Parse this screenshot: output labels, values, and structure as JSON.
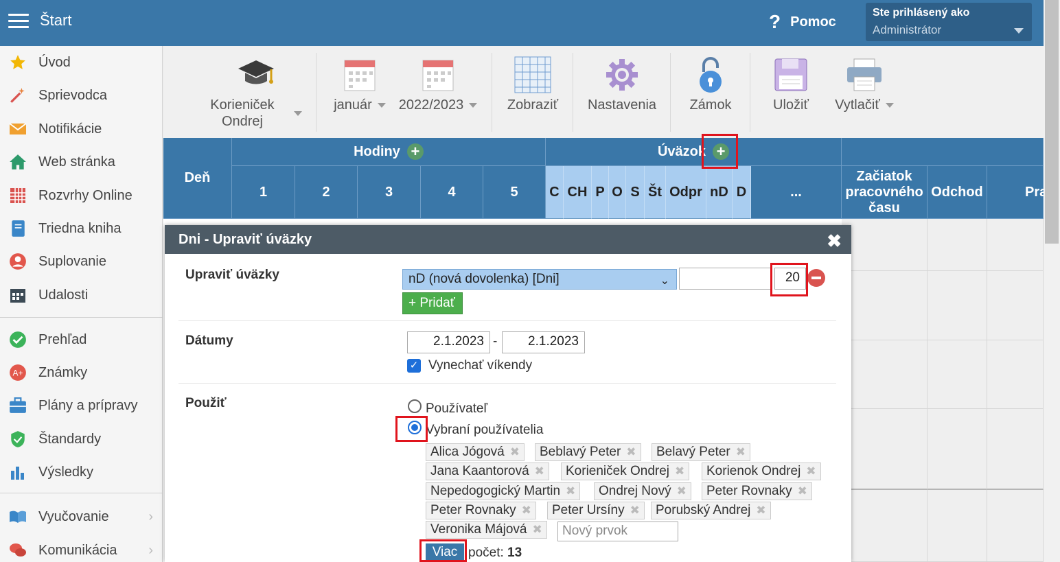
{
  "topbar": {
    "title": "Štart",
    "help_label": "Pomoc",
    "user_line1": "Ste prihlásený ako",
    "user_line2": "Administrátor"
  },
  "sidebar": {
    "items": [
      {
        "label": "Úvod",
        "icon": "star-icon"
      },
      {
        "label": "Sprievodca",
        "icon": "magic-wand-icon"
      },
      {
        "label": "Notifikácie",
        "icon": "envelope-icon"
      },
      {
        "label": "Web stránka",
        "icon": "house-icon"
      },
      {
        "label": "Rozvrhy Online",
        "icon": "timetable-grid-icon"
      },
      {
        "label": "Triedna kniha",
        "icon": "notebook-icon"
      },
      {
        "label": "Suplovanie",
        "icon": "user-icon"
      },
      {
        "label": "Udalosti",
        "icon": "calendar-icon"
      },
      {
        "label": "Prehľad",
        "icon": "check-circle-icon"
      },
      {
        "label": "Známky",
        "icon": "grade-circle-icon"
      },
      {
        "label": "Plány a prípravy",
        "icon": "briefcase-icon"
      },
      {
        "label": "Štandardy",
        "icon": "shield-check-icon"
      },
      {
        "label": "Výsledky",
        "icon": "bar-chart-icon"
      },
      {
        "label": "Vyučovanie",
        "icon": "open-book-icon"
      },
      {
        "label": "Komunikácia",
        "icon": "chat-bubbles-icon"
      }
    ]
  },
  "toolbar": {
    "teacher_line1": "Korieniček",
    "teacher_line2": "Ondrej",
    "month": "január",
    "year": "2022/2023",
    "show": "Zobraziť",
    "settings": "Nastavenia",
    "lock": "Zámok",
    "save": "Uložiť",
    "print": "Vytlačiť"
  },
  "grid": {
    "den": "Deň",
    "hodiny": "Hodiny",
    "uvazok": "Úväzok",
    "hours": [
      "1",
      "2",
      "3",
      "4",
      "5"
    ],
    "types": [
      "C",
      "CH",
      "P",
      "O",
      "S",
      "Št",
      "Odpr",
      "nD",
      "D"
    ],
    "more": "...",
    "start_time": "Začiatok pracovného času",
    "departure": "Odchod",
    "partial": "Pra"
  },
  "modal": {
    "title": "Dni - Upraviť úväzky",
    "edit_label": "Upraviť úväzky",
    "select_value": "nD (nová dovolenka) [Dni]",
    "amount": "20",
    "add_button": "+ Pridať",
    "dates_label": "Dátumy",
    "date_from": "2.1.2023",
    "date_to": "2.1.2023",
    "date_dash": "-",
    "skip_weekends": "Vynechať víkendy",
    "use_label": "Použiť",
    "opt_user": "Používateľ",
    "opt_selected": "Vybraní používatelia",
    "users": [
      "Alica Jógová",
      "Beblavý Peter",
      "Belavý Peter",
      "Jana Kaantorová",
      "Korieniček Ondrej",
      "Korienok Ondrej",
      "Nepedogogický Martin",
      "Ondrej Nový",
      "Peter Rovnaky",
      "Peter Rovnaky",
      "Peter Ursíny",
      "Porubský Andrej",
      "Veronika Májová"
    ],
    "new_item_placeholder": "Nový prvok",
    "more_button": "Viac",
    "count_label": "počet:",
    "count_value": "13"
  }
}
